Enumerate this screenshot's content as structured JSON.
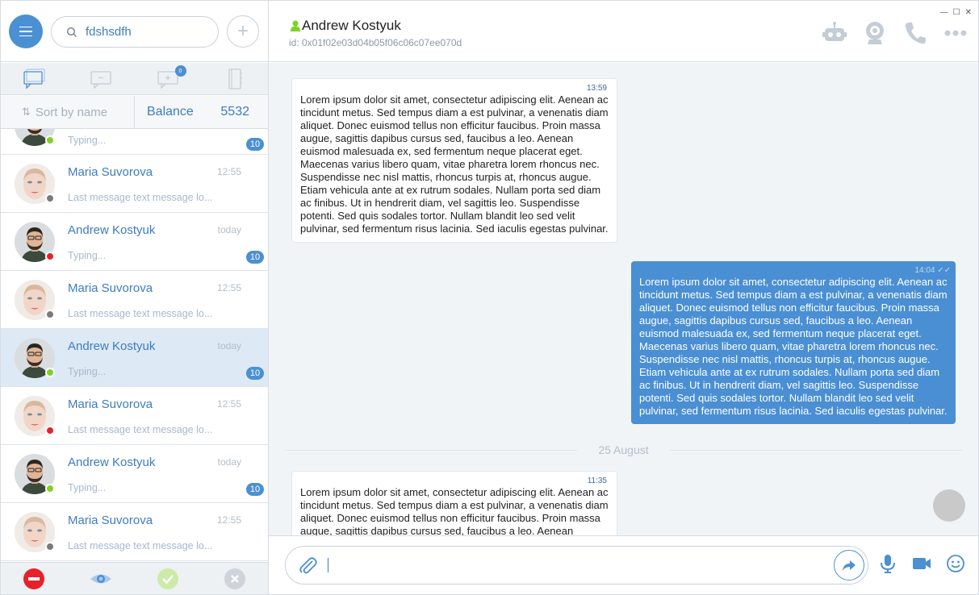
{
  "search": {
    "value": "fdshsdfh"
  },
  "sort": {
    "label": "Sort by name"
  },
  "balance": {
    "label": "Balance",
    "value": "5532"
  },
  "tabs": {
    "requests_badge": "0"
  },
  "contacts": [
    {
      "name": "",
      "time": "",
      "msg": "Typing...",
      "badge": "10",
      "status": "#7ed321",
      "avatar": "man"
    },
    {
      "name": "Maria Suvorova",
      "time": "12:55",
      "msg": "Last message text message lo...",
      "badge": "",
      "status": "#7a7a7a",
      "avatar": "woman"
    },
    {
      "name": "Andrew Kostyuk",
      "time": "today",
      "msg": "Typing...",
      "badge": "10",
      "status": "#e8202a",
      "avatar": "man"
    },
    {
      "name": "Maria Suvorova",
      "time": "12:55",
      "msg": "Last message text message lo...",
      "badge": "",
      "status": "#7a7a7a",
      "avatar": "woman"
    },
    {
      "name": "Andrew Kostyuk",
      "time": "today",
      "msg": "Typing...",
      "badge": "10",
      "status": "#7ed321",
      "avatar": "man"
    },
    {
      "name": "Maria Suvorova",
      "time": "12:55",
      "msg": "Last message text message lo...",
      "badge": "",
      "status": "#e8202a",
      "avatar": "woman"
    },
    {
      "name": "Andrew Kostyuk",
      "time": "today",
      "msg": "Typing...",
      "badge": "10",
      "status": "#7ed321",
      "avatar": "man"
    },
    {
      "name": "Maria Suvorova",
      "time": "12:55",
      "msg": "Last message text message lo...",
      "badge": "",
      "status": "#7a7a7a",
      "avatar": "woman"
    }
  ],
  "header": {
    "name": "Andrew Kostyuk",
    "id": "id: 0x01f02e03d04b05f06c06c07ee070d",
    "online_color": "#7ed321"
  },
  "messages": [
    {
      "time": "13:59",
      "text": "Lorem ipsum dolor sit amet, consectetur adipiscing elit. Aenean ac tincidunt metus. Sed tempus diam a est pulvinar, a venenatis diam aliquet. Donec euismod tellus non efficitur faucibus. Proin massa augue, sagittis dapibus cursus sed, faucibus a leo. Aenean euismod malesuada ex, sed fermentum neque placerat eget. Maecenas varius libero quam, vitae pharetra lorem rhoncus nec. Suspendisse nec nisl mattis, rhoncus turpis at, rhoncus augue. Etiam vehicula ante at ex rutrum sodales. Nullam porta sed diam ac finibus. Ut in hendrerit diam, vel sagittis leo. Suspendisse potenti. Sed quis sodales tortor. Nullam blandit leo sed velit pulvinar, sed fermentum risus lacinia. Sed iaculis egestas pulvinar."
    },
    {
      "time": "14:04",
      "text": "Lorem ipsum dolor sit amet, consectetur adipiscing elit. Aenean ac tincidunt metus. Sed tempus diam a est pulvinar, a venenatis diam aliquet. Donec euismod tellus non efficitur faucibus. Proin massa augue, sagittis dapibus cursus sed, faucibus a leo. Aenean euismod malesuada ex, sed fermentum neque placerat eget. Maecenas varius libero quam, vitae pharetra lorem rhoncus nec. Suspendisse nec nisl mattis, rhoncus turpis at, rhoncus augue. Etiam vehicula ante at ex rutrum sodales. Nullam porta sed diam ac finibus. Ut in hendrerit diam, vel sagittis leo. Suspendisse potenti. Sed quis sodales tortor. Nullam blandit leo sed velit pulvinar, sed fermentum risus lacinia. Sed iaculis egestas pulvinar."
    },
    {
      "time": "11:35",
      "text": "Lorem ipsum dolor sit amet, consectetur adipiscing elit. Aenean ac tincidunt metus. Sed tempus diam a est pulvinar, a venenatis diam aliquet. Donec euismod tellus non efficitur faucibus. Proin massa augue, sagittis dapibus cursus sed, faucibus a leo. Aenean"
    }
  ],
  "date_separator": "25 August",
  "colors": {
    "accent": "#4a90d2",
    "icon_gray": "#c4ccd5"
  }
}
